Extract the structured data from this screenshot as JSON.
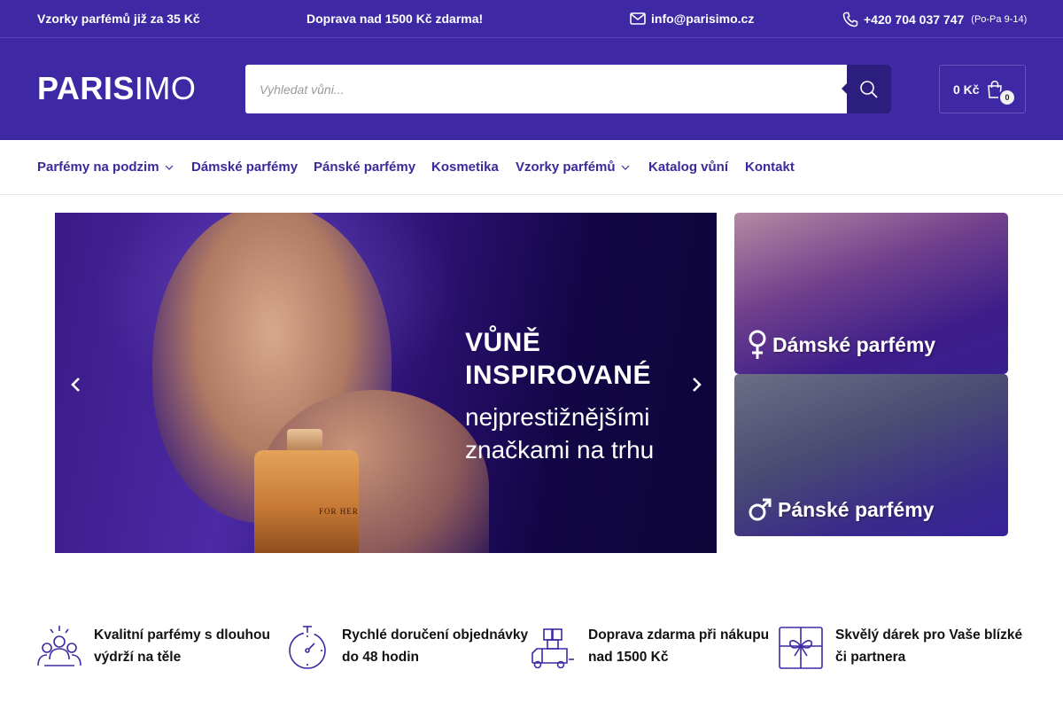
{
  "topbar": {
    "samples": "Vzorky parfémů již za 35 Kč",
    "shipping": "Doprava nad 1500 Kč zdarma!",
    "email": "info@parisimo.cz",
    "phone": "+420 704 037 747",
    "hours": "(Po-Pa 9-14)"
  },
  "header": {
    "logo_bold": "PARIS",
    "logo_light": "IMO",
    "search_placeholder": "Vyhledat vůni...",
    "cart_total": "0 Kč",
    "cart_count": "0"
  },
  "nav": {
    "items": [
      {
        "label": "Parfémy na podzim",
        "has_dropdown": true
      },
      {
        "label": "Dámské parfémy",
        "has_dropdown": false
      },
      {
        "label": "Pánské parfémy",
        "has_dropdown": false
      },
      {
        "label": "Kosmetika",
        "has_dropdown": false
      },
      {
        "label": "Vzorky parfémů",
        "has_dropdown": true
      },
      {
        "label": "Katalog vůní",
        "has_dropdown": false
      },
      {
        "label": "Kontakt",
        "has_dropdown": false
      }
    ]
  },
  "banner": {
    "headline_1": "VŮNĚ",
    "headline_2": "INSPIROVANÉ",
    "sub_1": "nejprestižnějšími",
    "sub_2": "značkami na trhu",
    "bottle_label": "FOR HER"
  },
  "tiles": {
    "women": "Dámské parfémy",
    "men": "Pánské parfémy"
  },
  "features": [
    {
      "icon": "people-icon",
      "line1": "Kvalitní parfémy s dlouhou",
      "line2": "výdrží na těle"
    },
    {
      "icon": "stopwatch-icon",
      "line1": "Rychlé doručení objednávky",
      "line2": "do 48 hodin"
    },
    {
      "icon": "truck-icon",
      "line1": "Doprava zdarma při nákupu",
      "line2": "nad 1500 Kč"
    },
    {
      "icon": "gift-icon",
      "line1": "Skvělý dárek pro Vaše blízké",
      "line2": "či partnera"
    }
  ],
  "colors": {
    "brand": "#3f28a4",
    "brand_dark": "#2c1e7d",
    "nav_text": "#3a2a9c"
  }
}
